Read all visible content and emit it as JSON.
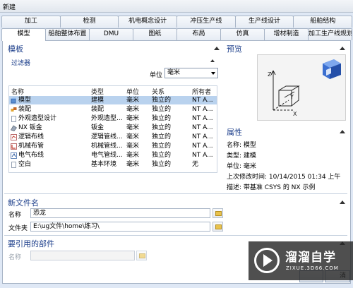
{
  "window": {
    "title": "新建"
  },
  "tabs_row1": [
    "加工",
    "检测",
    "机电概念设计",
    "冲压生产线",
    "生产线设计",
    "船舶结构"
  ],
  "tabs_row2": [
    "模型",
    "船舶整体布置",
    "DMU",
    "图纸",
    "布局",
    "仿真",
    "增材制造",
    "加工生产线规划器"
  ],
  "templates": {
    "title": "模板",
    "filter_title": "过滤器",
    "unit_label": "单位",
    "unit_value": "毫米",
    "columns": [
      "名称",
      "类型",
      "单位",
      "关系",
      "所有者"
    ],
    "rows": [
      {
        "name": "模型",
        "type": "建模",
        "unit": "毫米",
        "relation": "独立的",
        "owner": "NT A..."
      },
      {
        "name": "装配",
        "type": "装配",
        "unit": "毫米",
        "relation": "独立的",
        "owner": "NT A..."
      },
      {
        "name": "外观造型设计",
        "type": "外观造型...",
        "unit": "毫米",
        "relation": "独立的",
        "owner": "NT A..."
      },
      {
        "name": "NX 钣金",
        "type": "钣金",
        "unit": "毫米",
        "relation": "独立的",
        "owner": "NT A..."
      },
      {
        "name": "逻辑布线",
        "type": "逻辑管线...",
        "unit": "毫米",
        "relation": "独立的",
        "owner": "NT A..."
      },
      {
        "name": "机械布管",
        "type": "机械管线...",
        "unit": "毫米",
        "relation": "独立的",
        "owner": "NT A..."
      },
      {
        "name": "电气布线",
        "type": "电气管线...",
        "unit": "毫米",
        "relation": "独立的",
        "owner": "NT A..."
      },
      {
        "name": "空白",
        "type": "基本环境",
        "unit": "毫米",
        "relation": "独立的",
        "owner": "无"
      }
    ]
  },
  "preview": {
    "title": "预览"
  },
  "properties": {
    "title": "属性",
    "lines": [
      "名称:  模型",
      "类型:  建模",
      "单位:  毫米",
      "上次修改时间:   10/14/2015 01:34 上午",
      "描述:  带基准 CSYS 的 NX 示例"
    ]
  },
  "new_file": {
    "title": "新文件名",
    "name_label": "名称",
    "name_value": "恐龙",
    "folder_label": "文件夹",
    "folder_value": "E:\\ug文件\\home\\练习\\"
  },
  "referenced": {
    "title": "要引用的部件",
    "name_label": "名称",
    "name_value": ""
  },
  "buttons": {
    "cancel": "消"
  },
  "watermark": {
    "big": "溜溜自学",
    "small": "ZIXUE.3D66.COM"
  }
}
